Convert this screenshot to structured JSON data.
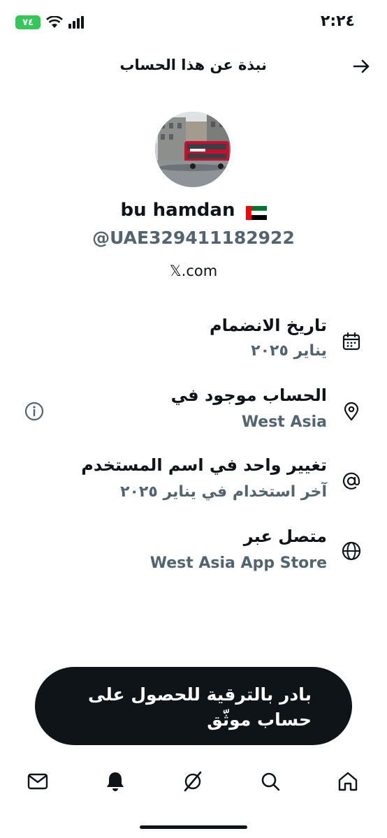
{
  "status_bar": {
    "time": "٢:٢٤",
    "battery": "٧٤"
  },
  "header": {
    "title": "نبذة عن هذا الحساب",
    "back_icon": "arrow-right-icon"
  },
  "profile": {
    "display_name": "bu hamdan",
    "flag_icon": "uae-flag-icon",
    "handle": "@UAE329411182922",
    "website": "𝕏.com"
  },
  "info_rows": [
    {
      "icon": "calendar-icon",
      "title": "تاريخ الانضمام",
      "value": "يناير ٢٠٢٥"
    },
    {
      "icon": "location-pin-icon",
      "title": "الحساب موجود في",
      "value": "West Asia"
    },
    {
      "icon": "at-sign-icon",
      "title": "تغيير واحد في اسم المستخدم",
      "value": "آخر استخدام في يناير ٢٠٢٥"
    },
    {
      "icon": "globe-icon",
      "title": "متصل عبر",
      "value": "West Asia App Store"
    }
  ],
  "cta": {
    "label": "بادر بالترقية للحصول على حساب موثّق"
  },
  "bottom_nav": [
    "messages-icon",
    "notifications-icon",
    "grok-icon",
    "search-icon",
    "home-icon"
  ],
  "colors": {
    "text": "#0f1419",
    "secondary": "#536471",
    "battery": "#34c759",
    "flag_green": "#00732f",
    "flag_red": "#ff0000",
    "flag_black": "#000000"
  }
}
